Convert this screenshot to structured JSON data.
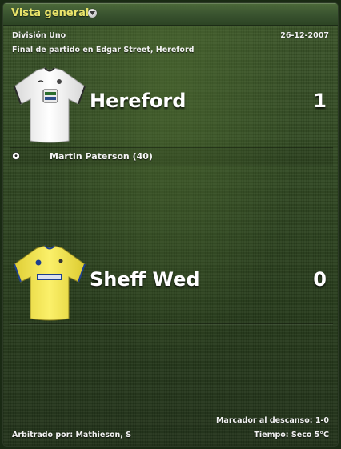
{
  "header": {
    "title": "Vista general",
    "dropdown_icon": "chevron-down-icon"
  },
  "match": {
    "competition": "División Uno",
    "date": "26-12-2007",
    "status": "Final de partido en Edgar Street, Hereford"
  },
  "home": {
    "name": "Hereford",
    "score": "1",
    "kit_colors": {
      "shirt": "#f4f4f4",
      "trim": "#2a2a2a"
    },
    "scorers": [
      {
        "text": "Martin Paterson (40)",
        "icon": "ball-icon"
      }
    ]
  },
  "away": {
    "name": "Sheff Wed",
    "score": "0",
    "kit_colors": {
      "shirt": "#f3e64a",
      "trim": "#1d3f8f"
    }
  },
  "footer": {
    "halftime": "Marcador al descanso: 1-0",
    "referee": "Arbitrado por: Mathieson, S",
    "weather": "Tiempo: Seco 5°C"
  },
  "colors": {
    "header_title": "#e9e36a",
    "pitch_green": "#2f4621"
  }
}
